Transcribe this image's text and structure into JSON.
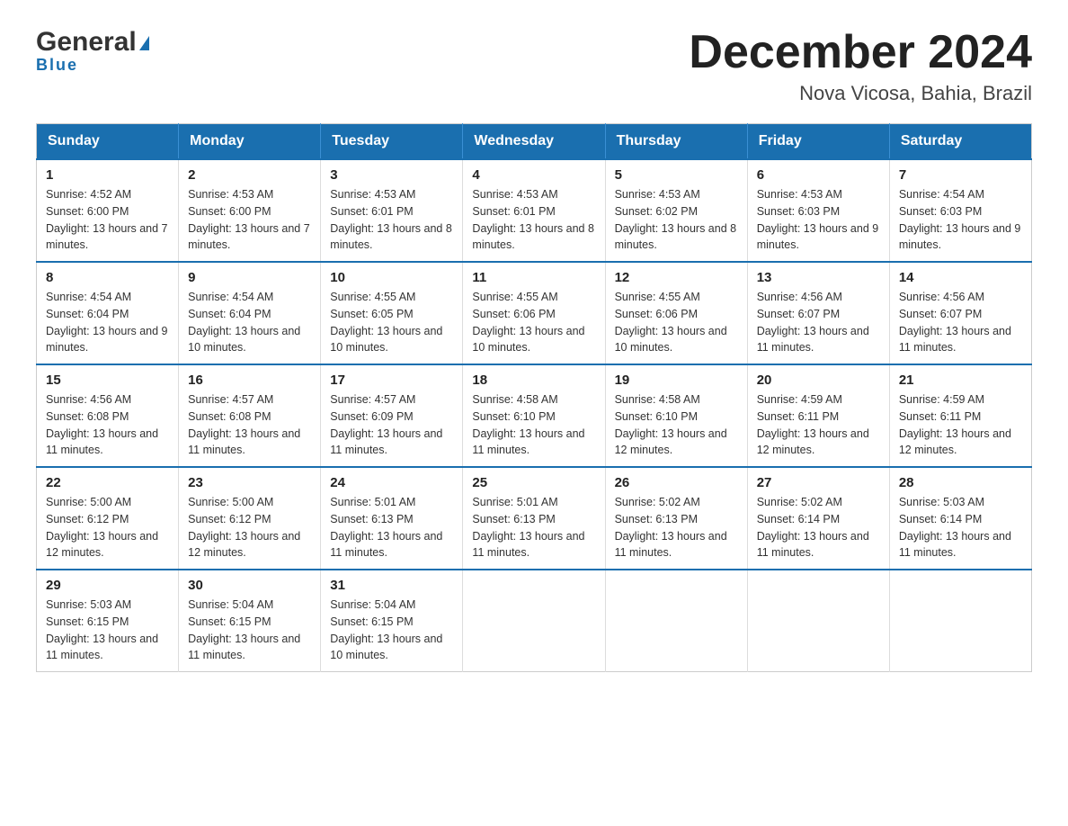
{
  "header": {
    "logo_main": "General",
    "logo_sub": "Blue",
    "title": "December 2024",
    "subtitle": "Nova Vicosa, Bahia, Brazil"
  },
  "days_of_week": [
    "Sunday",
    "Monday",
    "Tuesday",
    "Wednesday",
    "Thursday",
    "Friday",
    "Saturday"
  ],
  "weeks": [
    [
      {
        "day": "1",
        "sunrise": "4:52 AM",
        "sunset": "6:00 PM",
        "daylight": "13 hours and 7 minutes."
      },
      {
        "day": "2",
        "sunrise": "4:53 AM",
        "sunset": "6:00 PM",
        "daylight": "13 hours and 7 minutes."
      },
      {
        "day": "3",
        "sunrise": "4:53 AM",
        "sunset": "6:01 PM",
        "daylight": "13 hours and 8 minutes."
      },
      {
        "day": "4",
        "sunrise": "4:53 AM",
        "sunset": "6:01 PM",
        "daylight": "13 hours and 8 minutes."
      },
      {
        "day": "5",
        "sunrise": "4:53 AM",
        "sunset": "6:02 PM",
        "daylight": "13 hours and 8 minutes."
      },
      {
        "day": "6",
        "sunrise": "4:53 AM",
        "sunset": "6:03 PM",
        "daylight": "13 hours and 9 minutes."
      },
      {
        "day": "7",
        "sunrise": "4:54 AM",
        "sunset": "6:03 PM",
        "daylight": "13 hours and 9 minutes."
      }
    ],
    [
      {
        "day": "8",
        "sunrise": "4:54 AM",
        "sunset": "6:04 PM",
        "daylight": "13 hours and 9 minutes."
      },
      {
        "day": "9",
        "sunrise": "4:54 AM",
        "sunset": "6:04 PM",
        "daylight": "13 hours and 10 minutes."
      },
      {
        "day": "10",
        "sunrise": "4:55 AM",
        "sunset": "6:05 PM",
        "daylight": "13 hours and 10 minutes."
      },
      {
        "day": "11",
        "sunrise": "4:55 AM",
        "sunset": "6:06 PM",
        "daylight": "13 hours and 10 minutes."
      },
      {
        "day": "12",
        "sunrise": "4:55 AM",
        "sunset": "6:06 PM",
        "daylight": "13 hours and 10 minutes."
      },
      {
        "day": "13",
        "sunrise": "4:56 AM",
        "sunset": "6:07 PM",
        "daylight": "13 hours and 11 minutes."
      },
      {
        "day": "14",
        "sunrise": "4:56 AM",
        "sunset": "6:07 PM",
        "daylight": "13 hours and 11 minutes."
      }
    ],
    [
      {
        "day": "15",
        "sunrise": "4:56 AM",
        "sunset": "6:08 PM",
        "daylight": "13 hours and 11 minutes."
      },
      {
        "day": "16",
        "sunrise": "4:57 AM",
        "sunset": "6:08 PM",
        "daylight": "13 hours and 11 minutes."
      },
      {
        "day": "17",
        "sunrise": "4:57 AM",
        "sunset": "6:09 PM",
        "daylight": "13 hours and 11 minutes."
      },
      {
        "day": "18",
        "sunrise": "4:58 AM",
        "sunset": "6:10 PM",
        "daylight": "13 hours and 11 minutes."
      },
      {
        "day": "19",
        "sunrise": "4:58 AM",
        "sunset": "6:10 PM",
        "daylight": "13 hours and 12 minutes."
      },
      {
        "day": "20",
        "sunrise": "4:59 AM",
        "sunset": "6:11 PM",
        "daylight": "13 hours and 12 minutes."
      },
      {
        "day": "21",
        "sunrise": "4:59 AM",
        "sunset": "6:11 PM",
        "daylight": "13 hours and 12 minutes."
      }
    ],
    [
      {
        "day": "22",
        "sunrise": "5:00 AM",
        "sunset": "6:12 PM",
        "daylight": "13 hours and 12 minutes."
      },
      {
        "day": "23",
        "sunrise": "5:00 AM",
        "sunset": "6:12 PM",
        "daylight": "13 hours and 12 minutes."
      },
      {
        "day": "24",
        "sunrise": "5:01 AM",
        "sunset": "6:13 PM",
        "daylight": "13 hours and 11 minutes."
      },
      {
        "day": "25",
        "sunrise": "5:01 AM",
        "sunset": "6:13 PM",
        "daylight": "13 hours and 11 minutes."
      },
      {
        "day": "26",
        "sunrise": "5:02 AM",
        "sunset": "6:13 PM",
        "daylight": "13 hours and 11 minutes."
      },
      {
        "day": "27",
        "sunrise": "5:02 AM",
        "sunset": "6:14 PM",
        "daylight": "13 hours and 11 minutes."
      },
      {
        "day": "28",
        "sunrise": "5:03 AM",
        "sunset": "6:14 PM",
        "daylight": "13 hours and 11 minutes."
      }
    ],
    [
      {
        "day": "29",
        "sunrise": "5:03 AM",
        "sunset": "6:15 PM",
        "daylight": "13 hours and 11 minutes."
      },
      {
        "day": "30",
        "sunrise": "5:04 AM",
        "sunset": "6:15 PM",
        "daylight": "13 hours and 11 minutes."
      },
      {
        "day": "31",
        "sunrise": "5:04 AM",
        "sunset": "6:15 PM",
        "daylight": "13 hours and 10 minutes."
      },
      null,
      null,
      null,
      null
    ]
  ]
}
